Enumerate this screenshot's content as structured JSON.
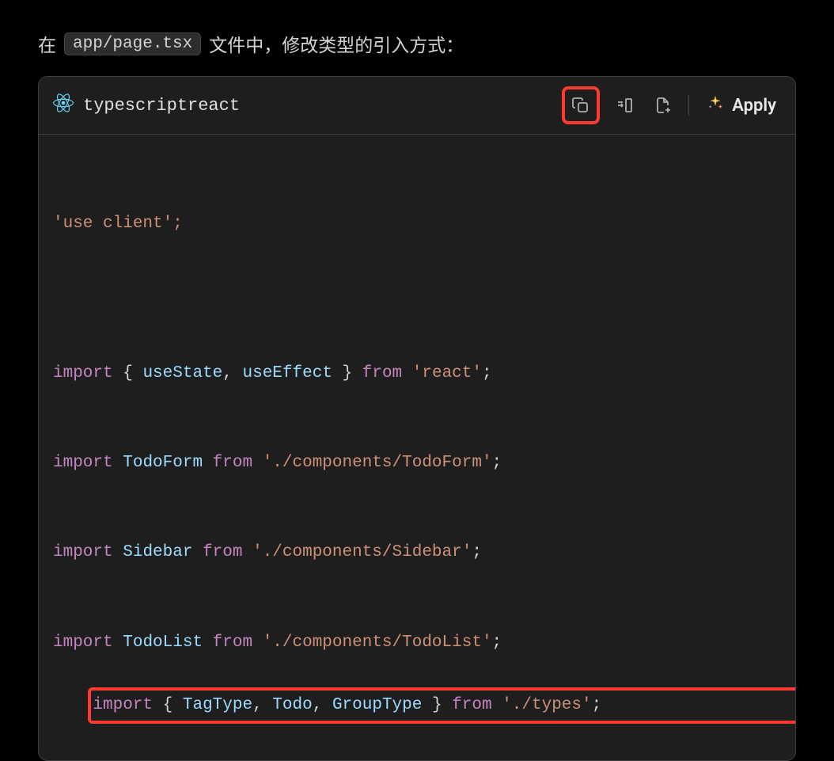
{
  "intro": {
    "prefix": "在",
    "file": "app/page.tsx",
    "suffix": "文件中，修改类型的引入方式："
  },
  "header": {
    "language": "typescriptreact",
    "apply_label": "Apply",
    "icons": {
      "react": "react-icon",
      "copy": "copy-icon",
      "insert": "insert-icon",
      "new_file": "new-file-icon",
      "sparkle": "sparkle-icon"
    }
  },
  "code": {
    "line1": "'use client';",
    "blank1": "",
    "line2": {
      "kw1": "import",
      "braceL": "{ ",
      "id1": "useState",
      "comma1": ", ",
      "id2": "useEffect",
      "braceR": " } ",
      "kw2": "from",
      "str": " 'react'",
      "semi": ";"
    },
    "line3": {
      "kw1": "import",
      "sp1": " ",
      "id1": "TodoForm",
      "sp2": " ",
      "kw2": "from",
      "str": " './components/TodoForm'",
      "semi": ";"
    },
    "line4": {
      "kw1": "import",
      "sp1": " ",
      "id1": "Sidebar",
      "sp2": " ",
      "kw2": "from",
      "str": " './components/Sidebar'",
      "semi": ";"
    },
    "line5": {
      "kw1": "import",
      "sp1": " ",
      "id1": "TodoList",
      "sp2": " ",
      "kw2": "from",
      "str": " './components/TodoList'",
      "semi": ";"
    },
    "line6": {
      "kw1": "import",
      "braceL": " { ",
      "id1": "TagType",
      "comma1": ", ",
      "id2": "Todo",
      "comma2": ", ",
      "id3": "GroupType",
      "braceR": " } ",
      "kw2": "from",
      "str": " './types'",
      "semi": ";"
    }
  }
}
